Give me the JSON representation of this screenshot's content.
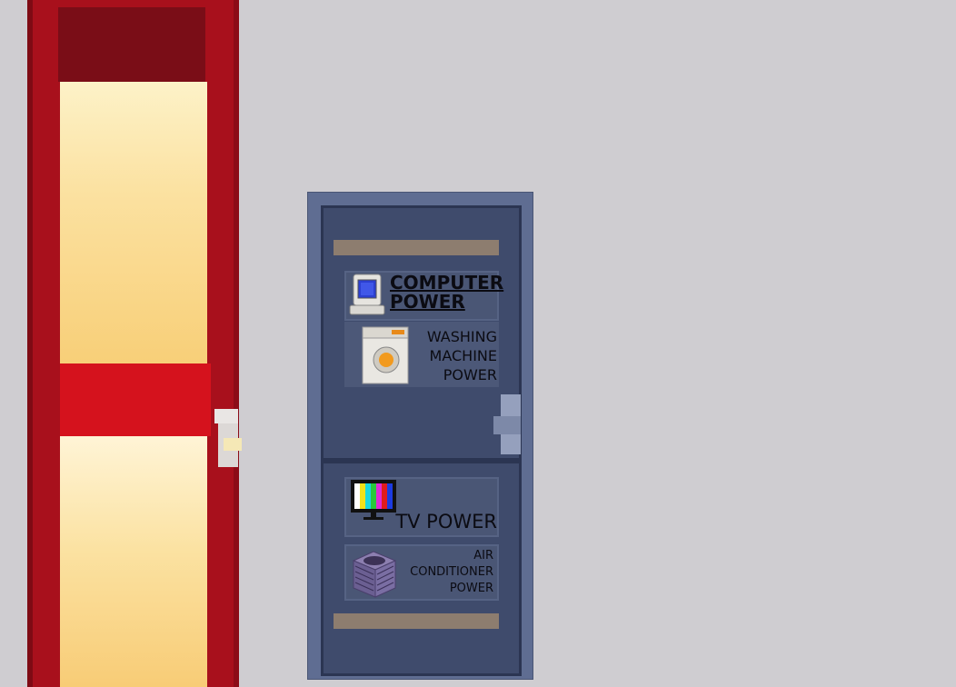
{
  "scene": {
    "colors": {
      "background": "#cfcdd1",
      "red_door": "#a8101c",
      "panel": "#3f4b6c",
      "strip": "#8d7d6f"
    }
  },
  "panel": {
    "breakers": [
      {
        "id": "computer",
        "label": "COMPUTER POWER",
        "icon": "computer-icon",
        "highlighted": true
      },
      {
        "id": "washer",
        "label_lines": [
          "WASHING",
          "MACHINE",
          "POWER"
        ],
        "icon": "washing-machine-icon"
      },
      {
        "id": "tv",
        "label": "TV POWER",
        "icon": "tv-icon"
      },
      {
        "id": "ac",
        "label_lines": [
          "AIR",
          "CONDITIONER",
          "POWER"
        ],
        "icon": "air-conditioner-icon"
      }
    ]
  }
}
